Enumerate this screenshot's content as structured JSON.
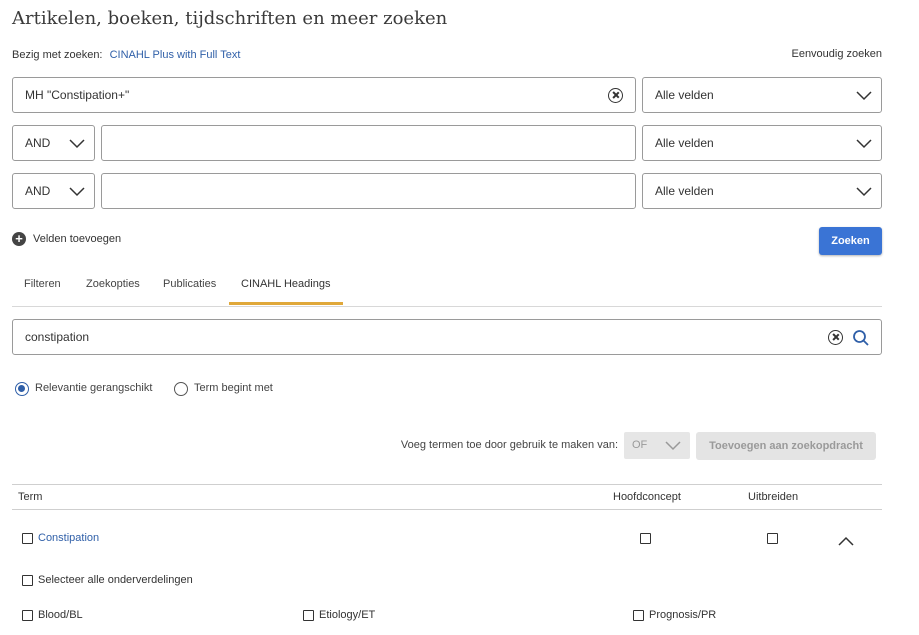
{
  "page": {
    "title": "Artikelen, boeken, tijdschriften en meer zoeken",
    "searching_label": "Bezig met zoeken:",
    "database": "CINAHL Plus with Full Text",
    "simple_search_link": "Eenvoudig zoeken"
  },
  "search_rows": [
    {
      "operator": null,
      "value": "MH \"Constipation+\"",
      "field": "Alle velden"
    },
    {
      "operator": "AND",
      "value": "",
      "field": "Alle velden"
    },
    {
      "operator": "AND",
      "value": "",
      "field": "Alle velden"
    }
  ],
  "actions": {
    "add_fields": "Velden toevoegen",
    "search_button": "Zoeken"
  },
  "tabs": [
    {
      "label": "Filteren",
      "active": false
    },
    {
      "label": "Zoekopties",
      "active": false
    },
    {
      "label": "Publicaties",
      "active": false
    },
    {
      "label": "CINAHL Headings",
      "active": true
    }
  ],
  "headings_search": {
    "value": "constipation"
  },
  "radio_options": [
    {
      "label": "Relevantie gerangschikt",
      "checked": true
    },
    {
      "label": "Term begint met",
      "checked": false
    }
  ],
  "combine": {
    "label": "Voeg termen toe door gebruik te maken van:",
    "operator": "OF",
    "add_button": "Toevoegen aan zoekopdracht"
  },
  "table": {
    "headers": {
      "term": "Term",
      "major": "Hoofdconcept",
      "explode": "Uitbreiden"
    },
    "rows": [
      {
        "term": "Constipation"
      }
    ],
    "select_all": "Selecteer alle onderverdelingen",
    "subheadings": [
      "Blood/BL",
      "Etiology/ET",
      "Prognosis/PR"
    ]
  },
  "colors": {
    "accent": "#3a74d5",
    "link": "#2f5fa8",
    "active_tab": "#e0a83a"
  }
}
